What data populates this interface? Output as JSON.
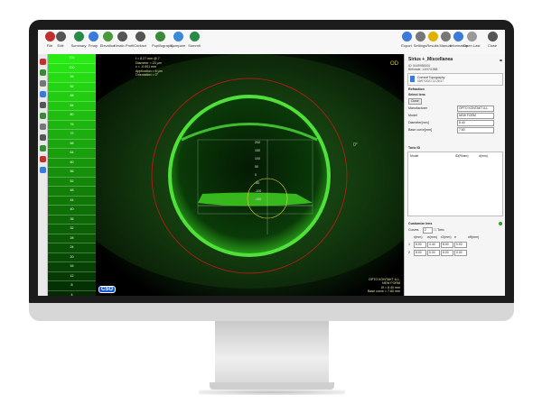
{
  "toolbar": {
    "left": [
      {
        "label": "File",
        "color": "#c03030"
      },
      {
        "label": "Edit",
        "color": "#555"
      },
      {
        "label": "Summary",
        "color": "#2a8a4a"
      },
      {
        "label": "Fmap",
        "color": "#3a7ad8"
      },
      {
        "label": "Elevation",
        "color": "#4a9a3a"
      },
      {
        "label": "Kerato Profil",
        "color": "#555"
      },
      {
        "label": "Contact",
        "color": "#555"
      },
      {
        "label": "Pupillography",
        "color": "#3a8a3a"
      },
      {
        "label": "Compare",
        "color": "#3a8ad8"
      },
      {
        "label": "Summit",
        "color": "#2a8a4a"
      }
    ],
    "right": [
      {
        "label": "Export",
        "color": "#3a7ad8"
      },
      {
        "label": "Settings",
        "color": "#777"
      },
      {
        "label": "Results",
        "color": "#e0b000"
      },
      {
        "label": "Manual",
        "color": "#777"
      },
      {
        "label": "Information",
        "color": "#3a7ad8"
      },
      {
        "label": "Open Last",
        "color": "#999"
      },
      {
        "label": "Close",
        "color": "#555"
      }
    ]
  },
  "scale": {
    "values": [
      "104",
      "100",
      "96",
      "92",
      "88",
      "84",
      "80",
      "76",
      "72",
      "68",
      "64",
      "60",
      "56",
      "52",
      "48",
      "44",
      "40",
      "36",
      "32",
      "28",
      "24",
      "20",
      "16",
      "12",
      "8",
      "4",
      "0"
    ],
    "unit": "[µm]"
  },
  "image": {
    "info": [
      "f = 8.27 mm @ 7",
      "Diameter = 23 µm",
      "z = -0.001 mm",
      "Application = 6 µm",
      "Orientation = 0°"
    ],
    "axis_labels": [
      "200",
      "150",
      "100",
      "50",
      "0",
      "-50",
      "-100",
      "-150"
    ],
    "bottom_right": [
      "OPTO KONTAKT A.L.",
      "NEW FORM",
      "Ø = 8.40 mm",
      "Base curve = 7.60 mm"
    ],
    "logo": "CSO",
    "angle": "0°"
  },
  "panel": {
    "patient_name": "Sirius +_Miscellanea",
    "patient_sub": [
      "ID: 5449958100",
      "Birthdate: 14/07/1988"
    ],
    "exam": [
      "Corneal Topography",
      "05/07/2021 11:28:47"
    ],
    "refraction_label": "Refraction",
    "select_lens_label": "Select lens",
    "close_button": "Close",
    "fields": [
      {
        "label": "Manufacturer",
        "value": "OPTO KONTAKT A.L."
      },
      {
        "label": "Model",
        "value": "NEW FORM"
      },
      {
        "label": "Diameter[mm]",
        "value": "8.40"
      },
      {
        "label": "Base curve[mm]",
        "value": "7.60"
      }
    ],
    "toric_label": "Toric ID",
    "toric_headers": [
      "Model",
      "ID(Rimm)",
      "d(mm)"
    ],
    "customize_label": "Customize lens",
    "curves_label": "Curves",
    "curves_value": "2",
    "toric_check": "Toric",
    "custom_headers": [
      "r(mm)",
      "w(mm)",
      "r2(mm)",
      "e",
      "off(mm)"
    ],
    "custom_rows": [
      {
        "label": "1",
        "values": [
          "6.00",
          "4.40",
          "8.00",
          "0.00"
        ]
      },
      {
        "label": "2",
        "values": [
          "8.00",
          "5.00",
          "8.00",
          "0.00"
        ]
      }
    ]
  }
}
